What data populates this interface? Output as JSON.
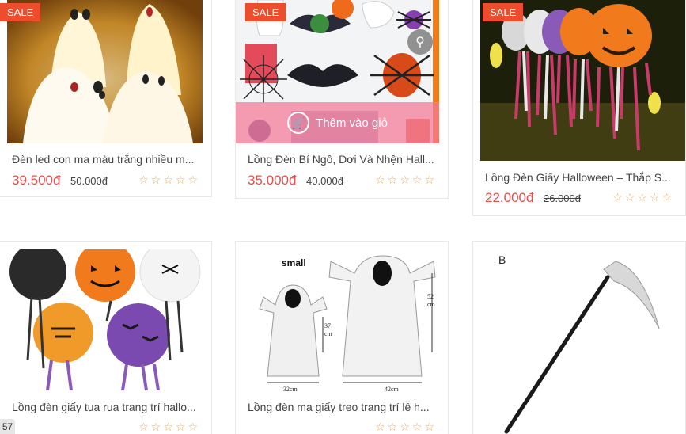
{
  "products": [
    {
      "sale": "SALE",
      "title": "Đèn led con ma màu trắng nhiều m...",
      "price": "39.500đ",
      "old_price": "50.000đ",
      "rating": "☆☆☆☆☆"
    },
    {
      "sale": "SALE",
      "title": "Lồng Đèn Bí Ngô, Dơi Và Nhện Hall...",
      "price": "35.000đ",
      "old_price": "40.000đ",
      "rating": "☆☆☆☆☆",
      "add_to_cart": "Thêm vào giỏ"
    },
    {
      "sale": "SALE",
      "title": "Lồng Đèn Giấy Halloween – Thắp S...",
      "price": "22.000đ",
      "old_price": "26.000đ",
      "rating": "☆☆☆☆☆"
    },
    {
      "title": "Lồng đèn giấy tua rua trang trí hallo...",
      "rating": "☆☆☆☆☆"
    },
    {
      "title": "Lồng đèn ma giấy treo trang trí lễ h...",
      "rating": "☆☆☆☆☆",
      "img_labels": {
        "small": "small",
        "w1": "32cm",
        "w2": "42cm",
        "h1": "37 cm",
        "h2": "52 cm"
      }
    },
    {
      "img_label": "B"
    }
  ],
  "page_indicator": "57",
  "colors": {
    "sale_badge": "#ee4d2d",
    "price": "#d9534f",
    "stars": "#f0a64a",
    "cart_bar": "#f47896"
  }
}
